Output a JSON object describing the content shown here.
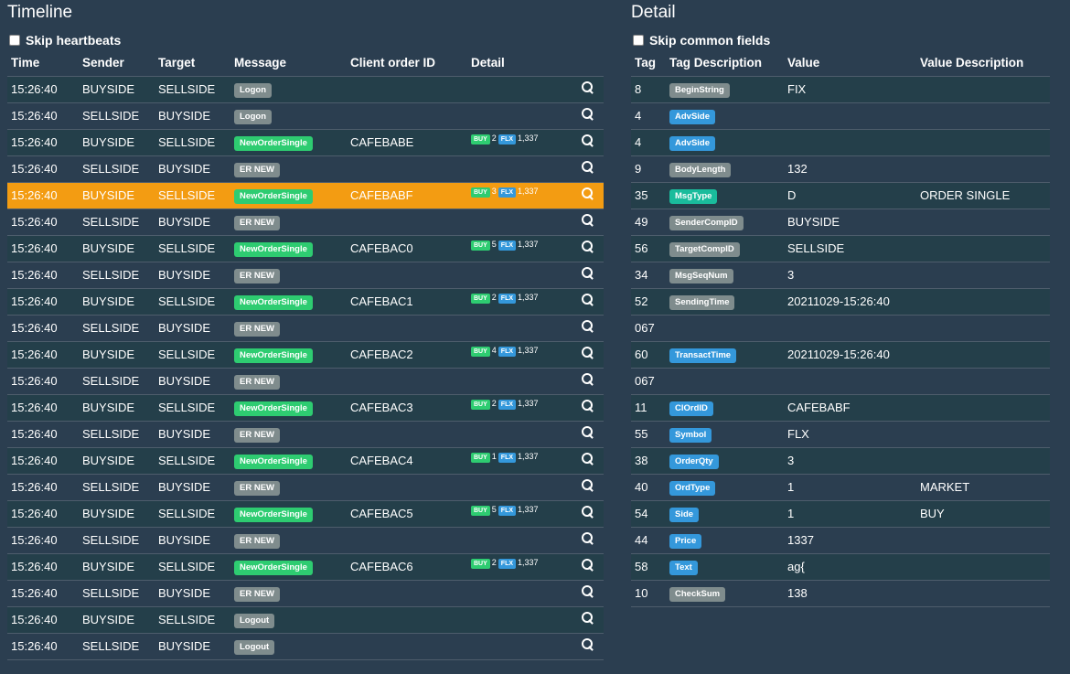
{
  "timeline": {
    "title": "Timeline",
    "skip_label": "Skip heartbeats",
    "columns": [
      "Time",
      "Sender",
      "Target",
      "Message",
      "Client order ID",
      "Detail"
    ],
    "rows": [
      {
        "time": "15:26:40",
        "sender": "BUYSIDE",
        "target": "SELLSIDE",
        "message": "Logon",
        "color": "#7f8c8d",
        "clordid": "",
        "side": "",
        "qty": "",
        "symbol": "",
        "price": ""
      },
      {
        "time": "15:26:40",
        "sender": "SELLSIDE",
        "target": "BUYSIDE",
        "message": "Logon",
        "color": "#7f8c8d",
        "clordid": "",
        "side": "",
        "qty": "",
        "symbol": "",
        "price": ""
      },
      {
        "time": "15:26:40",
        "sender": "BUYSIDE",
        "target": "SELLSIDE",
        "message": "NewOrderSingle",
        "color": "#2ecc71",
        "clordid": "CAFEBABE",
        "side": "BUY",
        "qty": "2",
        "symbol": "FLX",
        "price": "1,337"
      },
      {
        "time": "15:26:40",
        "sender": "SELLSIDE",
        "target": "BUYSIDE",
        "message": "ER NEW",
        "color": "#7f8c8d",
        "clordid": "",
        "side": "",
        "qty": "",
        "symbol": "",
        "price": ""
      },
      {
        "time": "15:26:40",
        "sender": "BUYSIDE",
        "target": "SELLSIDE",
        "message": "NewOrderSingle",
        "color": "#2ecc71",
        "clordid": "CAFEBABF",
        "side": "BUY",
        "qty": "3",
        "symbol": "FLX",
        "price": "1,337",
        "selected": true
      },
      {
        "time": "15:26:40",
        "sender": "SELLSIDE",
        "target": "BUYSIDE",
        "message": "ER NEW",
        "color": "#7f8c8d",
        "clordid": "",
        "side": "",
        "qty": "",
        "symbol": "",
        "price": ""
      },
      {
        "time": "15:26:40",
        "sender": "BUYSIDE",
        "target": "SELLSIDE",
        "message": "NewOrderSingle",
        "color": "#2ecc71",
        "clordid": "CAFEBAC0",
        "side": "BUY",
        "qty": "5",
        "symbol": "FLX",
        "price": "1,337"
      },
      {
        "time": "15:26:40",
        "sender": "SELLSIDE",
        "target": "BUYSIDE",
        "message": "ER NEW",
        "color": "#7f8c8d",
        "clordid": "",
        "side": "",
        "qty": "",
        "symbol": "",
        "price": ""
      },
      {
        "time": "15:26:40",
        "sender": "BUYSIDE",
        "target": "SELLSIDE",
        "message": "NewOrderSingle",
        "color": "#2ecc71",
        "clordid": "CAFEBAC1",
        "side": "BUY",
        "qty": "2",
        "symbol": "FLX",
        "price": "1,337"
      },
      {
        "time": "15:26:40",
        "sender": "SELLSIDE",
        "target": "BUYSIDE",
        "message": "ER NEW",
        "color": "#7f8c8d",
        "clordid": "",
        "side": "",
        "qty": "",
        "symbol": "",
        "price": ""
      },
      {
        "time": "15:26:40",
        "sender": "BUYSIDE",
        "target": "SELLSIDE",
        "message": "NewOrderSingle",
        "color": "#2ecc71",
        "clordid": "CAFEBAC2",
        "side": "BUY",
        "qty": "4",
        "symbol": "FLX",
        "price": "1,337"
      },
      {
        "time": "15:26:40",
        "sender": "SELLSIDE",
        "target": "BUYSIDE",
        "message": "ER NEW",
        "color": "#7f8c8d",
        "clordid": "",
        "side": "",
        "qty": "",
        "symbol": "",
        "price": ""
      },
      {
        "time": "15:26:40",
        "sender": "BUYSIDE",
        "target": "SELLSIDE",
        "message": "NewOrderSingle",
        "color": "#2ecc71",
        "clordid": "CAFEBAC3",
        "side": "BUY",
        "qty": "2",
        "symbol": "FLX",
        "price": "1,337"
      },
      {
        "time": "15:26:40",
        "sender": "SELLSIDE",
        "target": "BUYSIDE",
        "message": "ER NEW",
        "color": "#7f8c8d",
        "clordid": "",
        "side": "",
        "qty": "",
        "symbol": "",
        "price": ""
      },
      {
        "time": "15:26:40",
        "sender": "BUYSIDE",
        "target": "SELLSIDE",
        "message": "NewOrderSingle",
        "color": "#2ecc71",
        "clordid": "CAFEBAC4",
        "side": "BUY",
        "qty": "1",
        "symbol": "FLX",
        "price": "1,337"
      },
      {
        "time": "15:26:40",
        "sender": "SELLSIDE",
        "target": "BUYSIDE",
        "message": "ER NEW",
        "color": "#7f8c8d",
        "clordid": "",
        "side": "",
        "qty": "",
        "symbol": "",
        "price": ""
      },
      {
        "time": "15:26:40",
        "sender": "BUYSIDE",
        "target": "SELLSIDE",
        "message": "NewOrderSingle",
        "color": "#2ecc71",
        "clordid": "CAFEBAC5",
        "side": "BUY",
        "qty": "5",
        "symbol": "FLX",
        "price": "1,337"
      },
      {
        "time": "15:26:40",
        "sender": "SELLSIDE",
        "target": "BUYSIDE",
        "message": "ER NEW",
        "color": "#7f8c8d",
        "clordid": "",
        "side": "",
        "qty": "",
        "symbol": "",
        "price": ""
      },
      {
        "time": "15:26:40",
        "sender": "BUYSIDE",
        "target": "SELLSIDE",
        "message": "NewOrderSingle",
        "color": "#2ecc71",
        "clordid": "CAFEBAC6",
        "side": "BUY",
        "qty": "2",
        "symbol": "FLX",
        "price": "1,337"
      },
      {
        "time": "15:26:40",
        "sender": "SELLSIDE",
        "target": "BUYSIDE",
        "message": "ER NEW",
        "color": "#7f8c8d",
        "clordid": "",
        "side": "",
        "qty": "",
        "symbol": "",
        "price": ""
      },
      {
        "time": "15:26:40",
        "sender": "BUYSIDE",
        "target": "SELLSIDE",
        "message": "Logout",
        "color": "#7f8c8d",
        "clordid": "",
        "side": "",
        "qty": "",
        "symbol": "",
        "price": ""
      },
      {
        "time": "15:26:40",
        "sender": "SELLSIDE",
        "target": "BUYSIDE",
        "message": "Logout",
        "color": "#7f8c8d",
        "clordid": "",
        "side": "",
        "qty": "",
        "symbol": "",
        "price": ""
      }
    ],
    "row_icon": "zoom-in-icon",
    "selected_row_color": "#f39c12"
  },
  "detail": {
    "title": "Detail",
    "skip_label": "Skip common fields",
    "columns": [
      "Tag",
      "Tag Description",
      "Value",
      "Value Description"
    ],
    "rows": [
      {
        "tag": "8",
        "desc": "BeginString",
        "color": "#7f8c8d",
        "value": "FIX",
        "vdesc": ""
      },
      {
        "tag": "4",
        "desc": "AdvSide",
        "color": "#3498db",
        "value": "",
        "vdesc": ""
      },
      {
        "tag": "4",
        "desc": "AdvSide",
        "color": "#3498db",
        "value": "",
        "vdesc": ""
      },
      {
        "tag": "9",
        "desc": "BodyLength",
        "color": "#7f8c8d",
        "value": "132",
        "vdesc": ""
      },
      {
        "tag": "35",
        "desc": "MsgType",
        "color": "#1abc9c",
        "value": "D",
        "vdesc": "ORDER SINGLE"
      },
      {
        "tag": "49",
        "desc": "SenderCompID",
        "color": "#7f8c8d",
        "value": "BUYSIDE",
        "vdesc": ""
      },
      {
        "tag": "56",
        "desc": "TargetCompID",
        "color": "#7f8c8d",
        "value": "SELLSIDE",
        "vdesc": ""
      },
      {
        "tag": "34",
        "desc": "MsgSeqNum",
        "color": "#7f8c8d",
        "value": "3",
        "vdesc": ""
      },
      {
        "tag": "52",
        "desc": "SendingTime",
        "color": "#7f8c8d",
        "value": "20211029-15:26:40",
        "vdesc": ""
      },
      {
        "tag": "067",
        "desc": "",
        "color": "",
        "value": "",
        "vdesc": ""
      },
      {
        "tag": "60",
        "desc": "TransactTime",
        "color": "#3498db",
        "value": "20211029-15:26:40",
        "vdesc": ""
      },
      {
        "tag": "067",
        "desc": "",
        "color": "",
        "value": "",
        "vdesc": ""
      },
      {
        "tag": "11",
        "desc": "ClOrdID",
        "color": "#3498db",
        "value": "CAFEBABF",
        "vdesc": ""
      },
      {
        "tag": "55",
        "desc": "Symbol",
        "color": "#3498db",
        "value": "FLX",
        "vdesc": ""
      },
      {
        "tag": "38",
        "desc": "OrderQty",
        "color": "#3498db",
        "value": "3",
        "vdesc": ""
      },
      {
        "tag": "40",
        "desc": "OrdType",
        "color": "#3498db",
        "value": "1",
        "vdesc": "MARKET"
      },
      {
        "tag": "54",
        "desc": "Side",
        "color": "#3498db",
        "value": "1",
        "vdesc": "BUY"
      },
      {
        "tag": "44",
        "desc": "Price",
        "color": "#3498db",
        "value": "1337",
        "vdesc": ""
      },
      {
        "tag": "58",
        "desc": "Text",
        "color": "#3498db",
        "value": "ag{",
        "vdesc": ""
      },
      {
        "tag": "10",
        "desc": "CheckSum",
        "color": "#7f8c8d",
        "value": "138",
        "vdesc": ""
      }
    ]
  },
  "colors": {
    "background": "#2b3e50",
    "row_alt": "#243f4a",
    "side_badge": "#2ecc71",
    "symbol_badge": "#3498db"
  }
}
